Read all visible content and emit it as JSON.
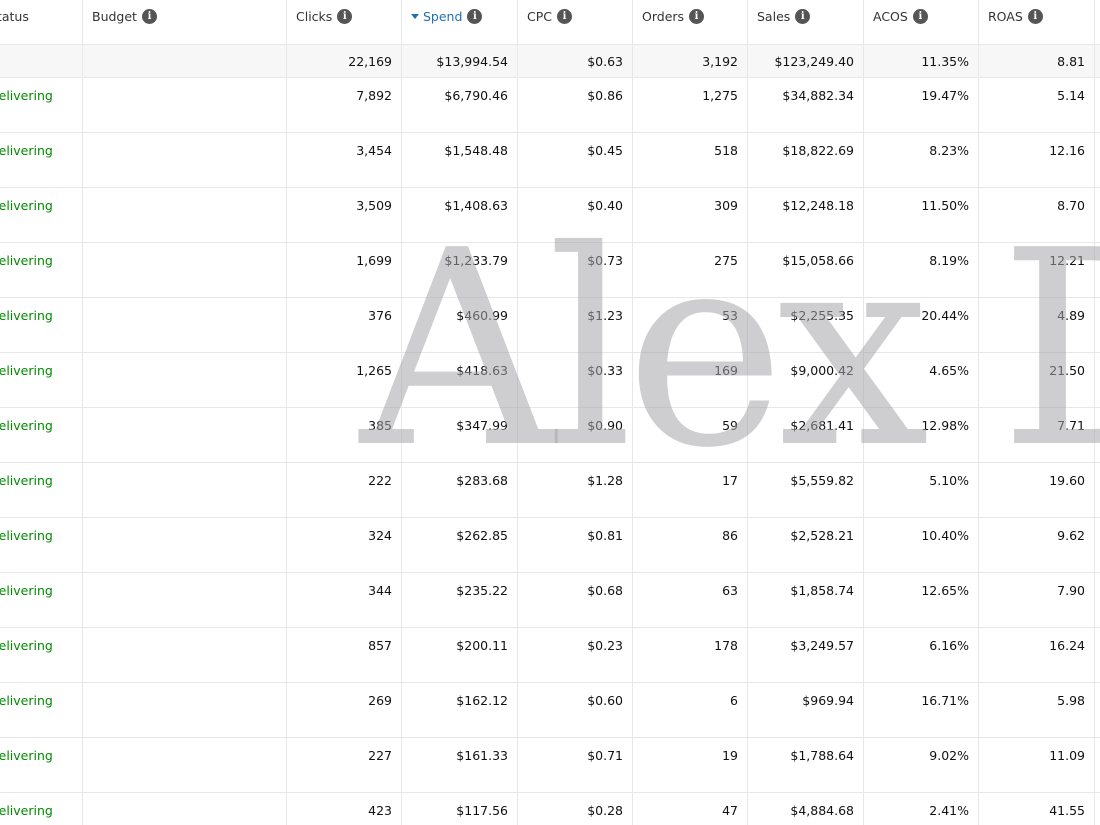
{
  "columns": {
    "status": "Status",
    "budget": "Budget",
    "clicks": "Clicks",
    "spend": "Spend",
    "cpc": "CPC",
    "orders": "Orders",
    "sales": "Sales",
    "acos": "ACOS",
    "roas": "ROAS"
  },
  "sorted_column": "spend",
  "totals": {
    "clicks": "22,169",
    "spend": "$13,994.54",
    "cpc": "$0.63",
    "orders": "3,192",
    "sales": "$123,249.40",
    "acos": "11.35%",
    "roas": "8.81"
  },
  "rows": [
    {
      "status": "Delivering",
      "budget": "",
      "clicks": "7,892",
      "spend": "$6,790.46",
      "cpc": "$0.86",
      "orders": "1,275",
      "sales": "$34,882.34",
      "acos": "19.47%",
      "roas": "5.14"
    },
    {
      "status": "Delivering",
      "budget": "",
      "clicks": "3,454",
      "spend": "$1,548.48",
      "cpc": "$0.45",
      "orders": "518",
      "sales": "$18,822.69",
      "acos": "8.23%",
      "roas": "12.16"
    },
    {
      "status": "Delivering",
      "budget": "",
      "clicks": "3,509",
      "spend": "$1,408.63",
      "cpc": "$0.40",
      "orders": "309",
      "sales": "$12,248.18",
      "acos": "11.50%",
      "roas": "8.70"
    },
    {
      "status": "Delivering",
      "budget": "",
      "clicks": "1,699",
      "spend": "$1,233.79",
      "cpc": "$0.73",
      "orders": "275",
      "sales": "$15,058.66",
      "acos": "8.19%",
      "roas": "12.21"
    },
    {
      "status": "Delivering",
      "budget": "",
      "clicks": "376",
      "spend": "$460.99",
      "cpc": "$1.23",
      "orders": "53",
      "sales": "$2,255.35",
      "acos": "20.44%",
      "roas": "4.89"
    },
    {
      "status": "Delivering",
      "budget": "",
      "clicks": "1,265",
      "spend": "$418.63",
      "cpc": "$0.33",
      "orders": "169",
      "sales": "$9,000.42",
      "acos": "4.65%",
      "roas": "21.50"
    },
    {
      "status": "Delivering",
      "budget": "",
      "clicks": "385",
      "spend": "$347.99",
      "cpc": "$0.90",
      "orders": "59",
      "sales": "$2,681.41",
      "acos": "12.98%",
      "roas": "7.71"
    },
    {
      "status": "Delivering",
      "budget": "",
      "clicks": "222",
      "spend": "$283.68",
      "cpc": "$1.28",
      "orders": "17",
      "sales": "$5,559.82",
      "acos": "5.10%",
      "roas": "19.60"
    },
    {
      "status": "Delivering",
      "budget": "",
      "clicks": "324",
      "spend": "$262.85",
      "cpc": "$0.81",
      "orders": "86",
      "sales": "$2,528.21",
      "acos": "10.40%",
      "roas": "9.62"
    },
    {
      "status": "Delivering",
      "budget": "",
      "clicks": "344",
      "spend": "$235.22",
      "cpc": "$0.68",
      "orders": "63",
      "sales": "$1,858.74",
      "acos": "12.65%",
      "roas": "7.90"
    },
    {
      "status": "Delivering",
      "budget": "",
      "clicks": "857",
      "spend": "$200.11",
      "cpc": "$0.23",
      "orders": "178",
      "sales": "$3,249.57",
      "acos": "6.16%",
      "roas": "16.24"
    },
    {
      "status": "Delivering",
      "budget": "",
      "clicks": "269",
      "spend": "$162.12",
      "cpc": "$0.60",
      "orders": "6",
      "sales": "$969.94",
      "acos": "16.71%",
      "roas": "5.98"
    },
    {
      "status": "Delivering",
      "budget": "",
      "clicks": "227",
      "spend": "$161.33",
      "cpc": "$0.71",
      "orders": "19",
      "sales": "$1,788.64",
      "acos": "9.02%",
      "roas": "11.09"
    },
    {
      "status": "Delivering",
      "budget": "",
      "clicks": "423",
      "spend": "$117.56",
      "cpc": "$0.28",
      "orders": "47",
      "sales": "$4,884.68",
      "acos": "2.41%",
      "roas": "41.55"
    }
  ],
  "watermark": "Alex D",
  "icons": {
    "info": "info-icon",
    "sort": "sort-descending-icon"
  },
  "colors": {
    "status_delivering": "#008a00",
    "sorted_header": "#1f6fb2",
    "totals_bg": "#f7f7f7"
  }
}
